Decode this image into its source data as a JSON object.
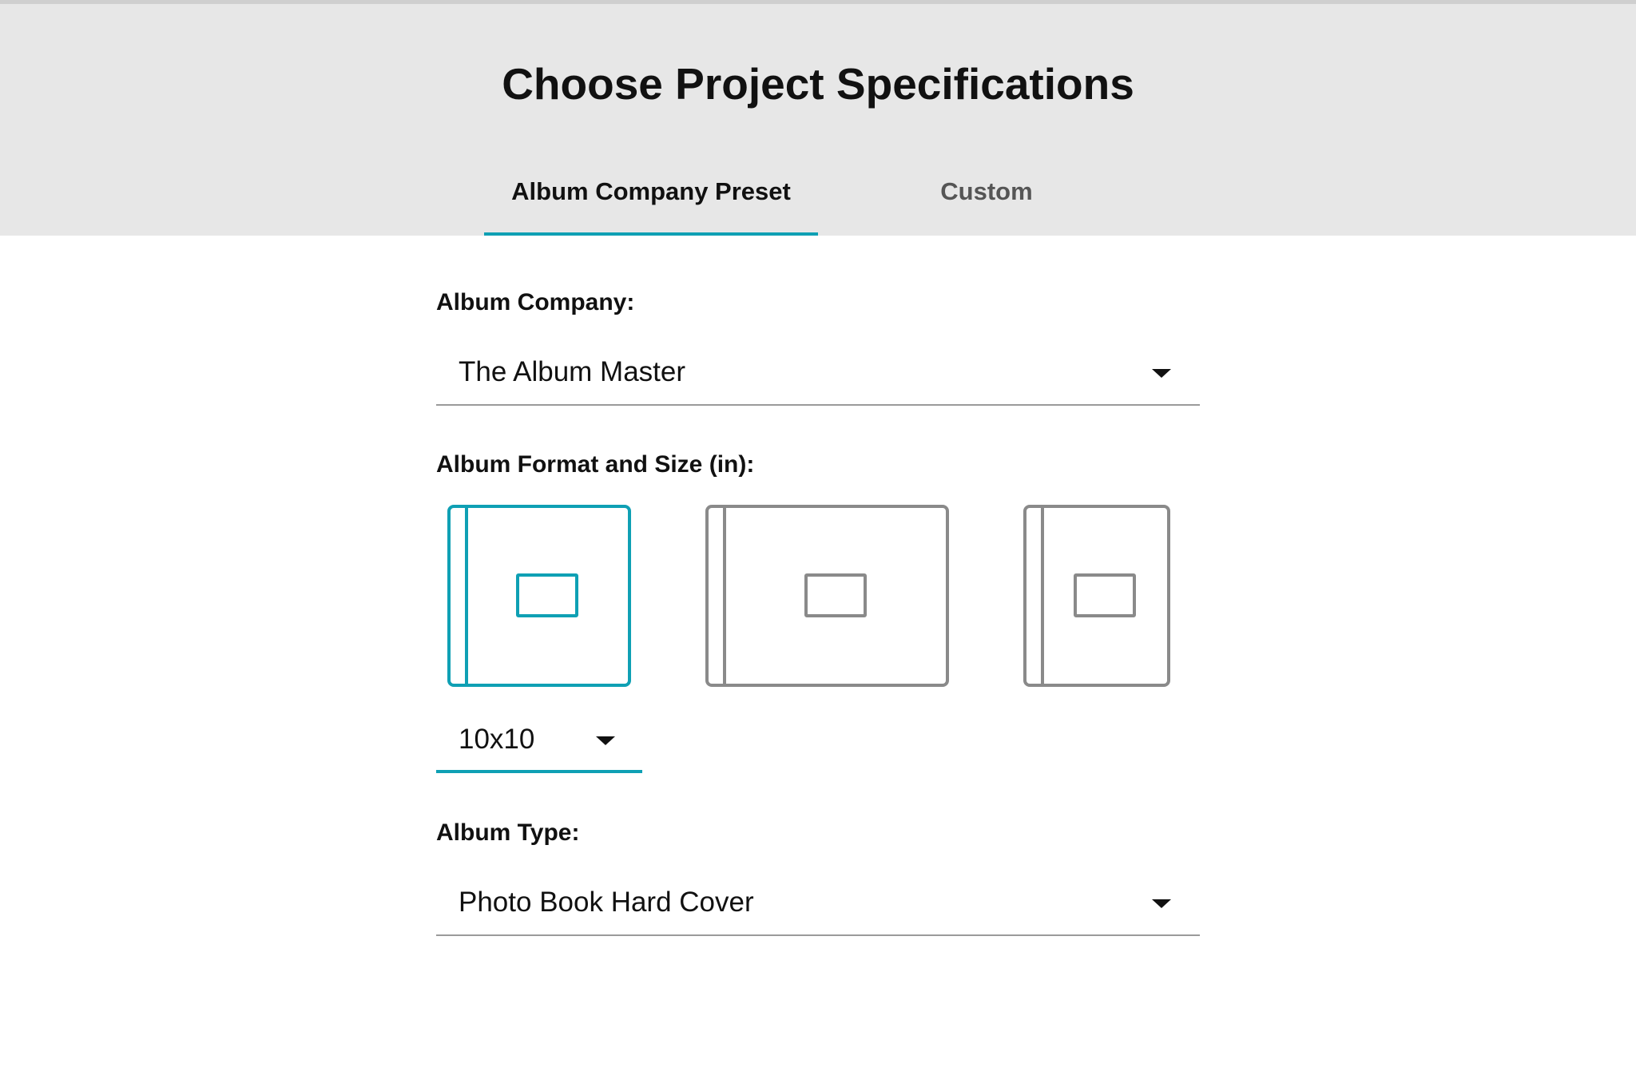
{
  "header": {
    "title": "Choose Project Specifications",
    "tabs": [
      {
        "label": "Album Company Preset",
        "active": true
      },
      {
        "label": "Custom",
        "active": false
      }
    ]
  },
  "form": {
    "album_company": {
      "label": "Album Company:",
      "value": "The Album Master"
    },
    "album_format": {
      "label": "Album Format and Size (in):",
      "options": [
        {
          "icon": "square-album-icon",
          "selected": true
        },
        {
          "icon": "landscape-album-icon",
          "selected": false
        },
        {
          "icon": "portrait-album-icon",
          "selected": false
        }
      ],
      "size_value": "10x10"
    },
    "album_type": {
      "label": "Album Type:",
      "value": "Photo Book Hard Cover"
    }
  },
  "colors": {
    "accent": "#0fa0b4",
    "header_bg": "#e7e7e7",
    "icon_gray": "#8a8a8a"
  },
  "icons": {
    "dropdown": "caret-down-icon"
  }
}
